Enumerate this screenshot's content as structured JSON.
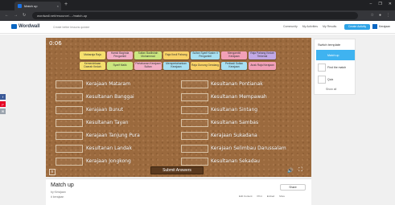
{
  "browser": {
    "tab_title": "Match up",
    "tab_close": "×",
    "new_tab": "+",
    "url": "wordwall.net/resource/..../match-up",
    "window_controls": [
      "–",
      "❐",
      "✕"
    ]
  },
  "header": {
    "logo": "Wordwall",
    "tagline": "Create better lessons quicker",
    "links": [
      "Community",
      "My Activities",
      "My Results"
    ],
    "create_button": "Create Activity",
    "user": "Kerajaan"
  },
  "game": {
    "timer": "0:06",
    "tiles_row1": [
      "Maharaja Raja",
      "Hamid Baginda Pengambil",
      "Sultan Badlishah Muhammad",
      "Raja Kecil Pahang",
      "Sultan Syarif Kasim II Pengambil",
      "Mengambil Kerajaan",
      "Raja Pahang Kedah Terkenal"
    ],
    "tiles_row2": [
      "Kemerdekaan Daerah Kedah",
      "Syarif Malik",
      "Pertahanan Kerajaan Sultan",
      "Mempertahankan Kerajaan",
      "Raja Gunung Gendang",
      "Peribadi Sultan Kerajaan",
      "Anak Raja Kerajaan"
    ],
    "left_labels": [
      "Kerajaan Mataram",
      "Kesultanan Banggai",
      "Kerajaan Bunut",
      "Kesultanan Tayan",
      "Kerajaan Tanjung Pura",
      "Kesultanan Landak",
      "Kerajaan Jongkong"
    ],
    "right_labels": [
      "Kesultanan Pontianak",
      "Kesultanan Mempawah",
      "Kesultanan Sintang",
      "Kesultanan Sambas",
      "Kerajaan Sukadana",
      "Kerajaan Selimbau Darussalam",
      "Kesultanan Sekadau"
    ],
    "submit": "Submit Answers",
    "menu_icon": "≡",
    "sound_icon": "🔊",
    "fullscreen_icon": "⛶"
  },
  "share_bar": [
    "f",
    "p",
    "✉"
  ],
  "templates": {
    "title": "Switch template",
    "items": [
      "Match up",
      "Find the match",
      "Quiz"
    ],
    "show_all": "Show all"
  },
  "activity": {
    "title": "Match up",
    "author": "by Kerajaan",
    "tag": "# kerajaan",
    "share_button": "Share",
    "actions": [
      "Edit Content",
      "Print",
      "Embed",
      "More"
    ]
  },
  "colors": {
    "tile_colors": [
      "#f6e06e",
      "#f3b0c6",
      "#cbe77f",
      "#f9d267",
      "#a8e0f2",
      "#f2a0b7",
      "#c2a9e6"
    ],
    "accent": "#3fb3f0",
    "board": "#9b6a3e"
  }
}
